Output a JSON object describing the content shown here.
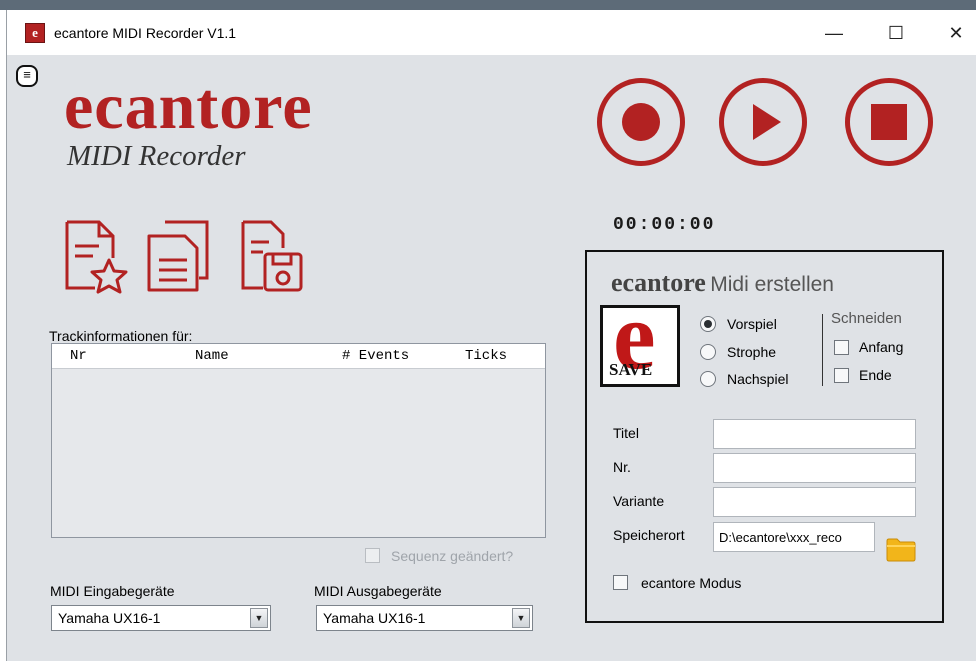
{
  "titlebar": {
    "title": "ecantore MIDI Recorder V1.1",
    "minimize_label": "—",
    "maximize_label": "☐",
    "close_label": "✕"
  },
  "menu_icon": "hamburger-menu-icon",
  "brand": {
    "name": "ecantore",
    "subtitle": "MIDI Recorder",
    "color": "#b22222"
  },
  "file_icons": [
    "new-favorite-document-icon",
    "copy-documents-icon",
    "save-document-icon"
  ],
  "transport": {
    "record_icon": "record-icon",
    "play_icon": "play-icon",
    "stop_icon": "stop-icon",
    "timer": "00:00:00"
  },
  "tracks": {
    "label": "Trackinformationen für:",
    "columns": [
      "Nr",
      "Name",
      "# Events",
      "Ticks"
    ],
    "rows": []
  },
  "sequence_changed": {
    "label": "Sequenz geändert?",
    "checked": false,
    "enabled": false
  },
  "midi_in": {
    "label": "MIDI Eingabegeräte",
    "selected": "Yamaha UX16-1"
  },
  "midi_out": {
    "label": "MIDI Ausgabegeräte",
    "selected": "Yamaha UX16-1"
  },
  "create_panel": {
    "title_brand": "ecantore",
    "title_rest": "Midi erstellen",
    "save_logo_letter": "e",
    "save_logo_text": "SAVE",
    "part_options": [
      {
        "label": "Vorspiel",
        "selected": true
      },
      {
        "label": "Strophe",
        "selected": false
      },
      {
        "label": "Nachspiel",
        "selected": false
      }
    ],
    "cut": {
      "label": "Schneiden",
      "start_label": "Anfang",
      "end_label": "Ende",
      "start_checked": false,
      "end_checked": false
    },
    "form": {
      "title_label": "Titel",
      "title_value": "",
      "number_label": "Nr.",
      "number_value": "",
      "variant_label": "Variante",
      "variant_value": "",
      "location_label": "Speicherort",
      "location_value": "D:\\ecantore\\xxx_reco"
    },
    "folder_icon": "folder-icon",
    "mode_label": "ecantore Modus",
    "mode_checked": false
  }
}
